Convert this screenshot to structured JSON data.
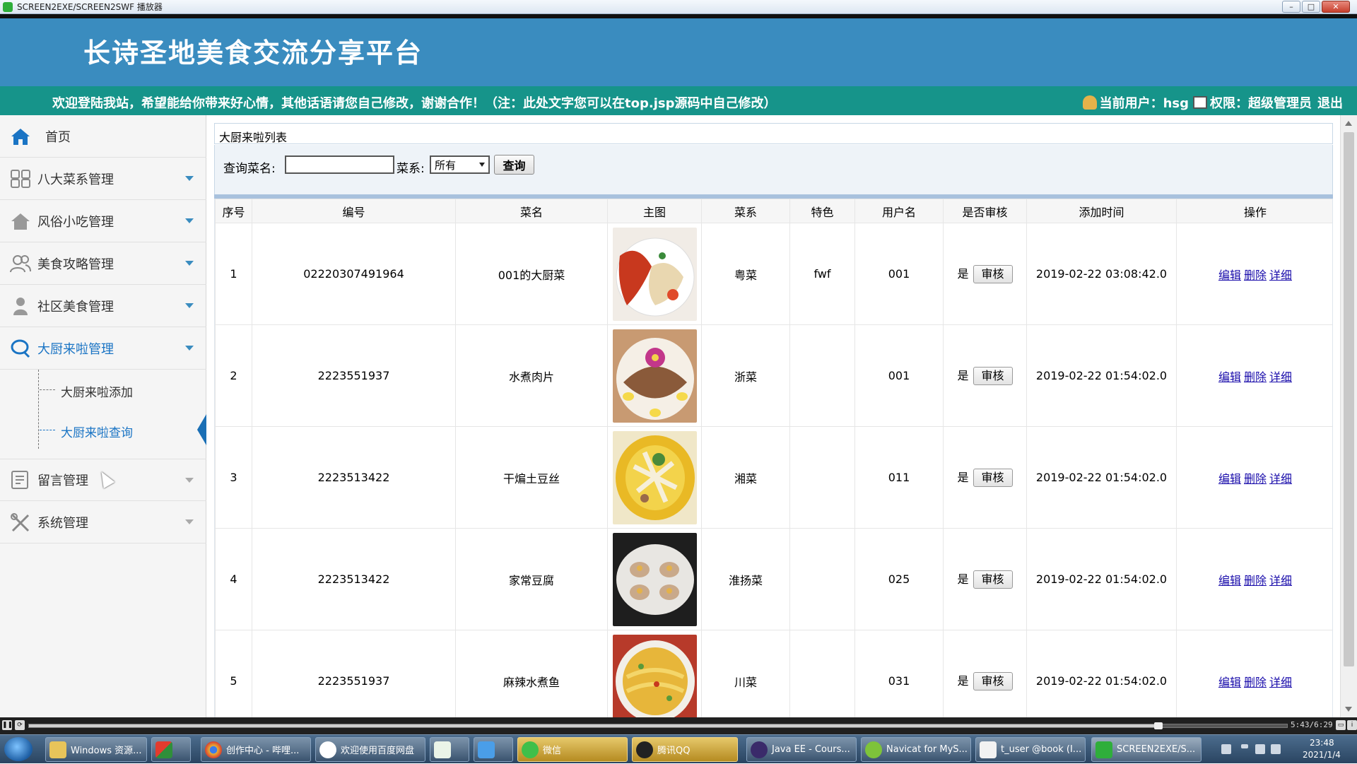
{
  "player": {
    "title": "SCREEN2EXE/SCREEN2SWF 播放器",
    "time": "5:43/6:29"
  },
  "site": {
    "title": "长诗圣地美食交流分享平台",
    "welcome": "欢迎登陆我站，希望能给你带来好心情，其他话语请您自己修改，谢谢合作！（注：此处文字您可以在top.jsp源码中自己修改）",
    "current_user_label": "当前用户：hsg",
    "role_label": "权限：超级管理员",
    "logout": "退出"
  },
  "sidebar": {
    "items": [
      {
        "label": "首页",
        "icon": "home-icon"
      },
      {
        "label": "八大菜系管理",
        "icon": "grid-icon"
      },
      {
        "label": "风俗小吃管理",
        "icon": "house-icon"
      },
      {
        "label": "美食攻略管理",
        "icon": "users-icon"
      },
      {
        "label": "社区美食管理",
        "icon": "person-icon"
      },
      {
        "label": "大厨来啦管理",
        "icon": "chat-icon"
      },
      {
        "label": "留言管理",
        "icon": "message-board-icon"
      },
      {
        "label": "系统管理",
        "icon": "tools-icon"
      }
    ],
    "sub_items": [
      {
        "label": "大厨来啦添加"
      },
      {
        "label": "大厨来啦查询"
      }
    ]
  },
  "main": {
    "panel_title": "大厨来啦列表",
    "search": {
      "name_label": "查询菜名:",
      "name_value": "",
      "cuisine_label": "菜系:",
      "cuisine_value": "所有",
      "button": "查询"
    },
    "table": {
      "headers": [
        "序号",
        "编号",
        "菜名",
        "主图",
        "菜系",
        "特色",
        "用户名",
        "是否审核",
        "添加时间",
        "操作"
      ],
      "audit_button": "审核",
      "ops": {
        "edit": "编辑",
        "delete": "删除",
        "detail": "详细"
      },
      "rows": [
        {
          "idx": "1",
          "code": "02220307491964",
          "name": "001的大厨菜",
          "image": "lobster-platter",
          "cuisine": "粤菜",
          "feature": "fwf",
          "user": "001",
          "audited": "是",
          "time": "2019-02-22 03:08:42.0"
        },
        {
          "idx": "2",
          "code": "2223551937",
          "name": "水煮肉片",
          "image": "sliced-meat-plate",
          "cuisine": "浙菜",
          "feature": "",
          "user": "001",
          "audited": "是",
          "time": "2019-02-22 01:54:02.0"
        },
        {
          "idx": "3",
          "code": "2223513422",
          "name": "干煸土豆丝",
          "image": "potato-soup-bowl",
          "cuisine": "湘菜",
          "feature": "",
          "user": "011",
          "audited": "是",
          "time": "2019-02-22 01:54:02.0"
        },
        {
          "idx": "4",
          "code": "2223513422",
          "name": "家常豆腐",
          "image": "scallop-plate",
          "cuisine": "淮扬菜",
          "feature": "",
          "user": "025",
          "audited": "是",
          "time": "2019-02-22 01:54:02.0"
        },
        {
          "idx": "5",
          "code": "2223551937",
          "name": "麻辣水煮鱼",
          "image": "fish-dumpling-plate",
          "cuisine": "川菜",
          "feature": "",
          "user": "031",
          "audited": "是",
          "time": "2019-02-22 01:54:02.0"
        }
      ]
    }
  },
  "taskbar": {
    "items": [
      {
        "label": "Windows 资源..."
      },
      {
        "label": ""
      },
      {
        "label": "创作中心 - 哔哩..."
      },
      {
        "label": "欢迎使用百度网盘"
      },
      {
        "label": ""
      },
      {
        "label": ""
      },
      {
        "label": "微信"
      },
      {
        "label": "腾讯QQ"
      },
      {
        "label": "Java EE - Cours..."
      },
      {
        "label": "Navicat for MyS..."
      },
      {
        "label": "t_user @book (I..."
      },
      {
        "label": "SCREEN2EXE/S..."
      }
    ],
    "clock_time": "23:48",
    "clock_date": "2021/1/4"
  },
  "colors": {
    "header_blue": "#3a8cbf",
    "bar_teal": "#16948a",
    "active_blue": "#1a74c4",
    "link_blue": "#1a0dab"
  }
}
